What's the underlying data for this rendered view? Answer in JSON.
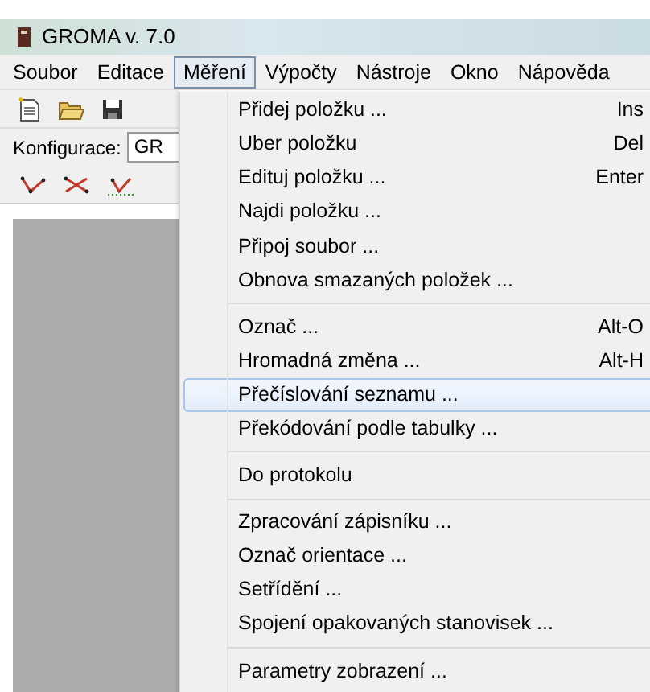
{
  "window": {
    "title": "GROMA v. 7.0"
  },
  "menubar": [
    {
      "label": "Soubor",
      "selected": false
    },
    {
      "label": "Editace",
      "selected": false
    },
    {
      "label": "Měření",
      "selected": true
    },
    {
      "label": "Výpočty",
      "selected": false
    },
    {
      "label": "Nástroje",
      "selected": false
    },
    {
      "label": "Okno",
      "selected": false
    },
    {
      "label": "Nápověda",
      "selected": false
    }
  ],
  "toolbar": [
    {
      "kind": "new"
    },
    {
      "kind": "open"
    },
    {
      "kind": "save"
    }
  ],
  "configuration": {
    "label": "Konfigurace:",
    "value": "GR"
  },
  "tools": [
    {
      "kind": "angle"
    },
    {
      "kind": "cross"
    },
    {
      "kind": "dotted"
    }
  ],
  "menu": [
    {
      "kind": "item",
      "label": "Přidej položku ...",
      "shortcut": "Ins",
      "selected": false
    },
    {
      "kind": "item",
      "label": "Uber položku",
      "shortcut": "Del",
      "selected": false
    },
    {
      "kind": "item",
      "label": "Edituj položku ...",
      "shortcut": "Enter",
      "selected": false
    },
    {
      "kind": "item",
      "label": "Najdi položku ...",
      "selected": false
    },
    {
      "kind": "item",
      "label": "Připoj soubor ...",
      "selected": false
    },
    {
      "kind": "item",
      "label": "Obnova smazaných položek ...",
      "selected": false
    },
    {
      "kind": "separator"
    },
    {
      "kind": "item",
      "label": "Označ ...",
      "shortcut": "Alt-O",
      "selected": false
    },
    {
      "kind": "item",
      "label": "Hromadná změna ...",
      "shortcut": "Alt-H",
      "selected": false
    },
    {
      "kind": "item",
      "label": "Přečíslování seznamu ...",
      "selected": true
    },
    {
      "kind": "item",
      "label": "Překódování podle tabulky ...",
      "selected": false
    },
    {
      "kind": "separator"
    },
    {
      "kind": "item",
      "label": "Do protokolu",
      "selected": false
    },
    {
      "kind": "separator"
    },
    {
      "kind": "item",
      "label": "Zpracování zápisníku ...",
      "selected": false
    },
    {
      "kind": "item",
      "label": "Označ orientace ...",
      "selected": false
    },
    {
      "kind": "item",
      "label": "Setřídění ...",
      "selected": false
    },
    {
      "kind": "item",
      "label": "Spojení opakovaných stanovisek ...",
      "selected": false
    },
    {
      "kind": "separator"
    },
    {
      "kind": "item",
      "label": "Parametry zobrazení ...",
      "selected": false
    }
  ]
}
